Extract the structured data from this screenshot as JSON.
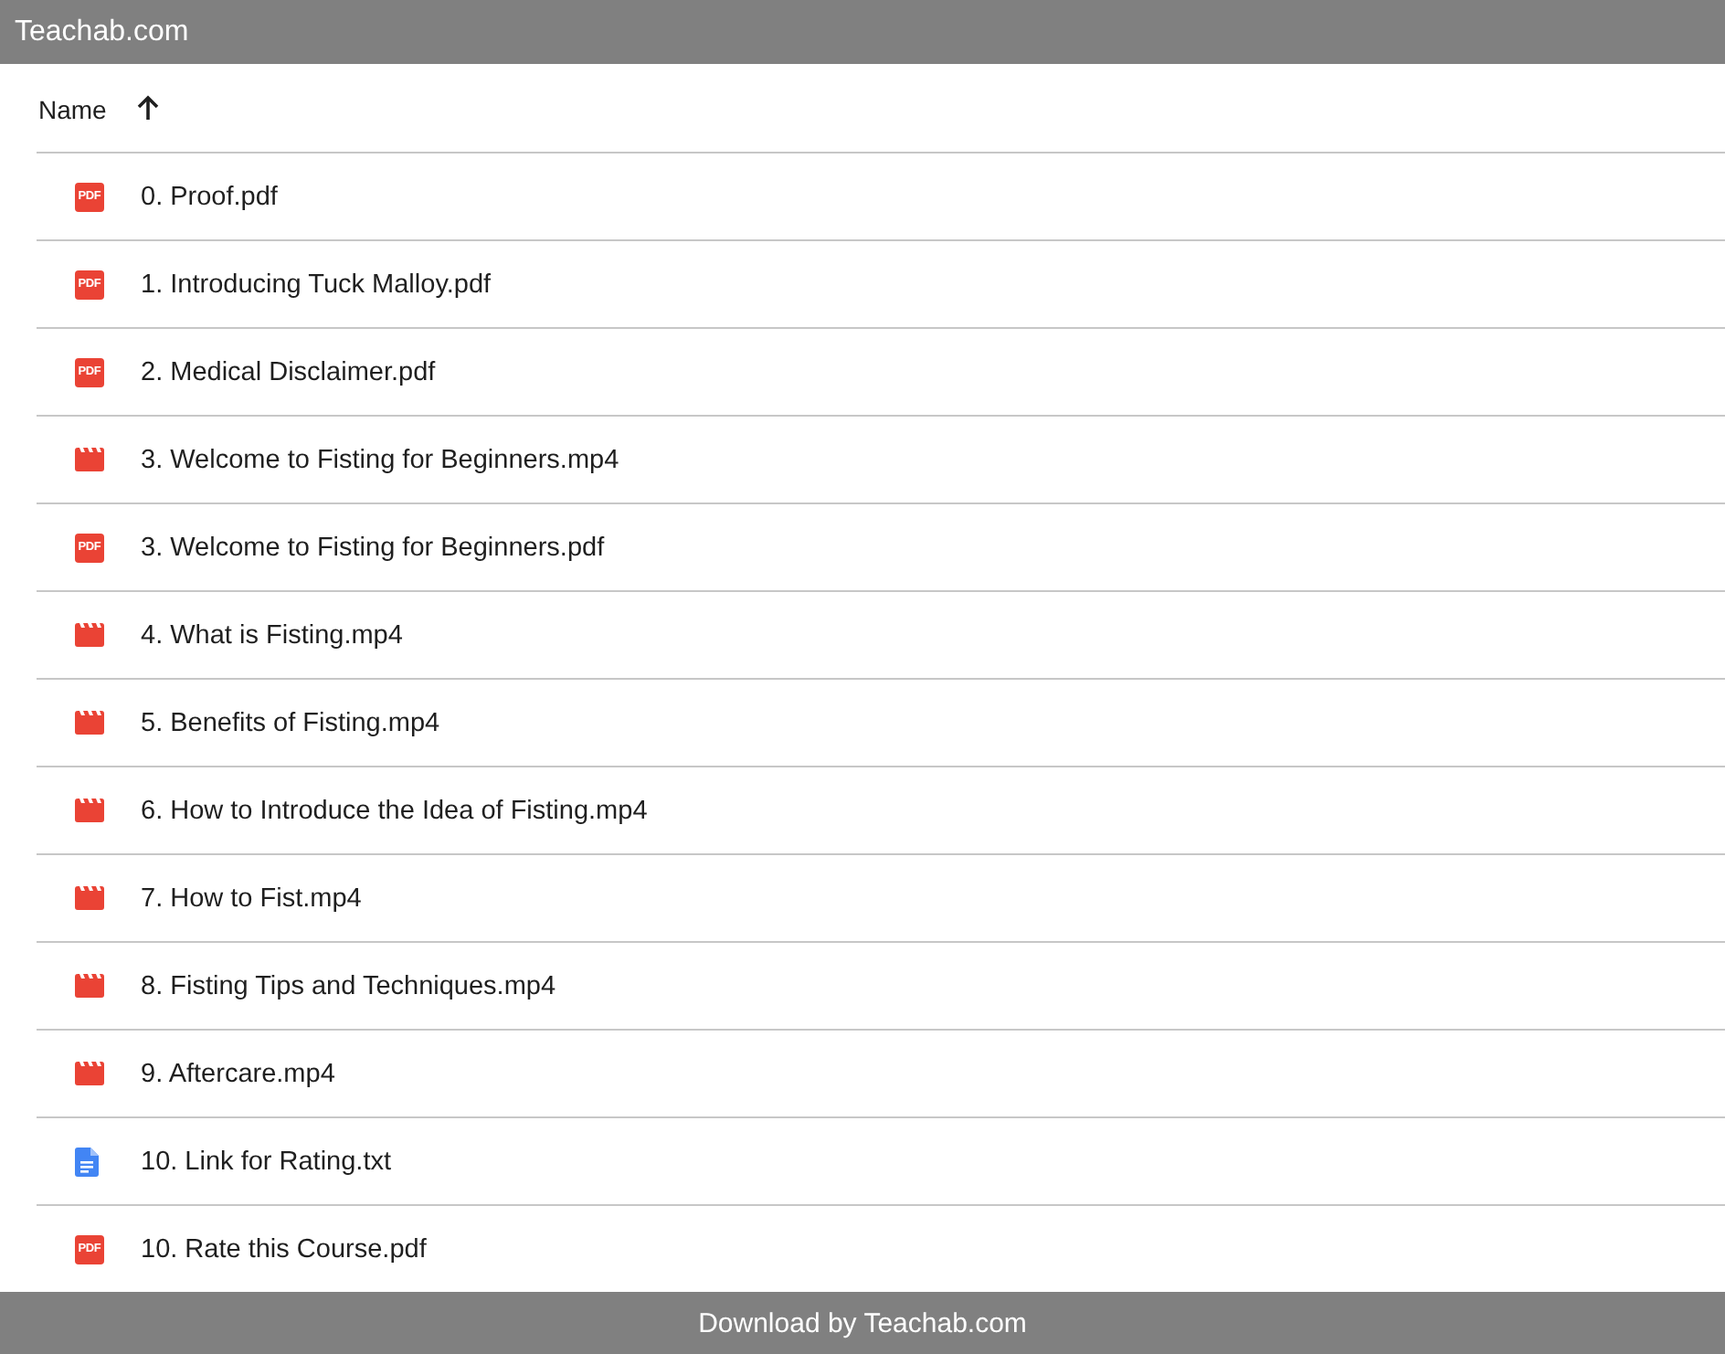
{
  "top_bar": {
    "title": "Teachab.com"
  },
  "list_header": {
    "label": "Name",
    "sort_ascending": true
  },
  "files": [
    {
      "name": "0. Proof.pdf",
      "kind": "pdf",
      "badge": "PDF"
    },
    {
      "name": "1. Introducing Tuck Malloy.pdf",
      "kind": "pdf",
      "badge": "PDF"
    },
    {
      "name": "2. Medical Disclaimer.pdf",
      "kind": "pdf",
      "badge": "PDF"
    },
    {
      "name": "3. Welcome to Fisting for Beginners.mp4",
      "kind": "video"
    },
    {
      "name": "3. Welcome to Fisting for Beginners.pdf",
      "kind": "pdf",
      "badge": "PDF"
    },
    {
      "name": "4. What is Fisting.mp4",
      "kind": "video"
    },
    {
      "name": "5. Benefits of Fisting.mp4",
      "kind": "video"
    },
    {
      "name": "6. How to Introduce the Idea of Fisting.mp4",
      "kind": "video"
    },
    {
      "name": "7. How to Fist.mp4",
      "kind": "video"
    },
    {
      "name": "8. Fisting Tips and Techniques.mp4",
      "kind": "video"
    },
    {
      "name": "9. Aftercare.mp4",
      "kind": "video"
    },
    {
      "name": "10. Link for Rating.txt",
      "kind": "text"
    },
    {
      "name": "10. Rate this Course.pdf",
      "kind": "pdf",
      "badge": "PDF"
    }
  ],
  "bottom_bar": {
    "text": "Download by Teachab.com"
  }
}
